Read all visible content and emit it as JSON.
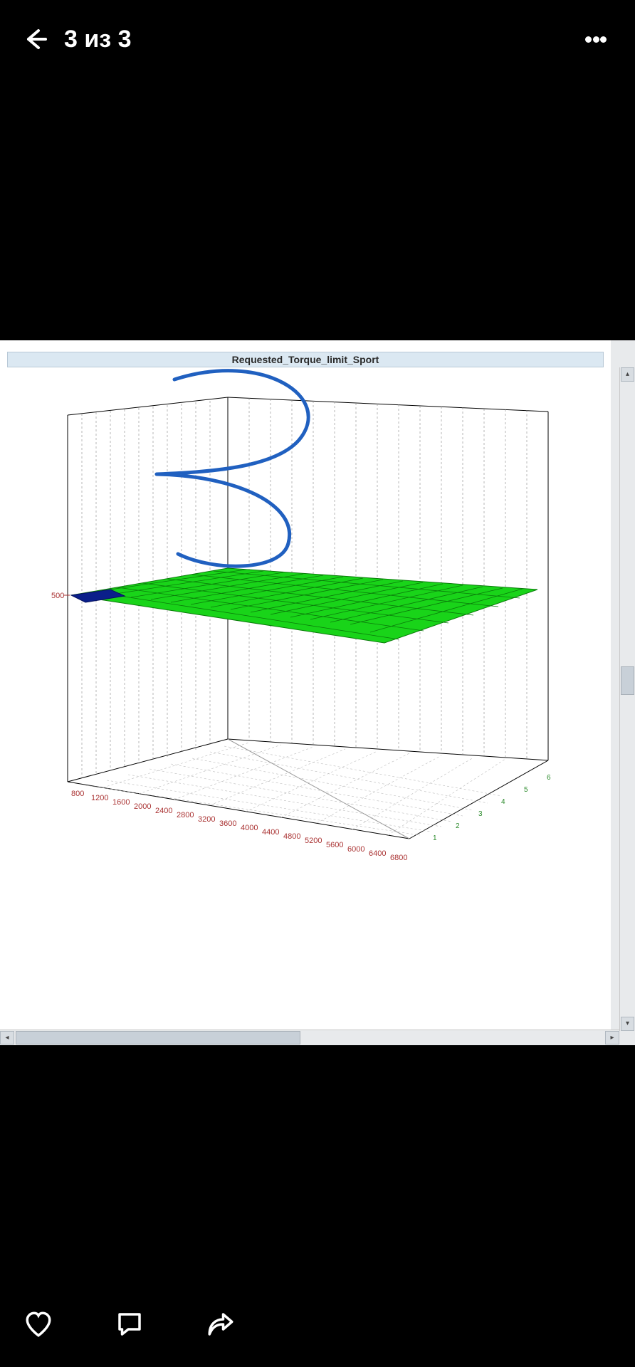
{
  "header": {
    "counter": "3 из 3"
  },
  "chart_data": {
    "type": "heatmap",
    "title": "Requested_Torque_limit_Sport",
    "xlabel": "",
    "ylabel": "",
    "zlabel": "",
    "z_ticks": [
      500
    ],
    "x_ticks": [
      800,
      1200,
      1600,
      2000,
      2400,
      2800,
      3200,
      3600,
      4000,
      4400,
      4800,
      5200,
      5600,
      6000,
      6400,
      6800
    ],
    "y_ticks": [
      1,
      2,
      3,
      4,
      5,
      6
    ],
    "values_note": "surface approximately flat at z≈500 across full x,y grid; small dark-blue corner near x≈800,y≈1 indicates slight dip below 500",
    "estimated_z": 500,
    "annotation": "hand-drawn blue '3' scribble overlaid, not part of data"
  },
  "icons": {
    "back": "back-icon",
    "more": "more-icon",
    "like": "heart-icon",
    "comment": "comment-icon",
    "share": "share-icon"
  }
}
